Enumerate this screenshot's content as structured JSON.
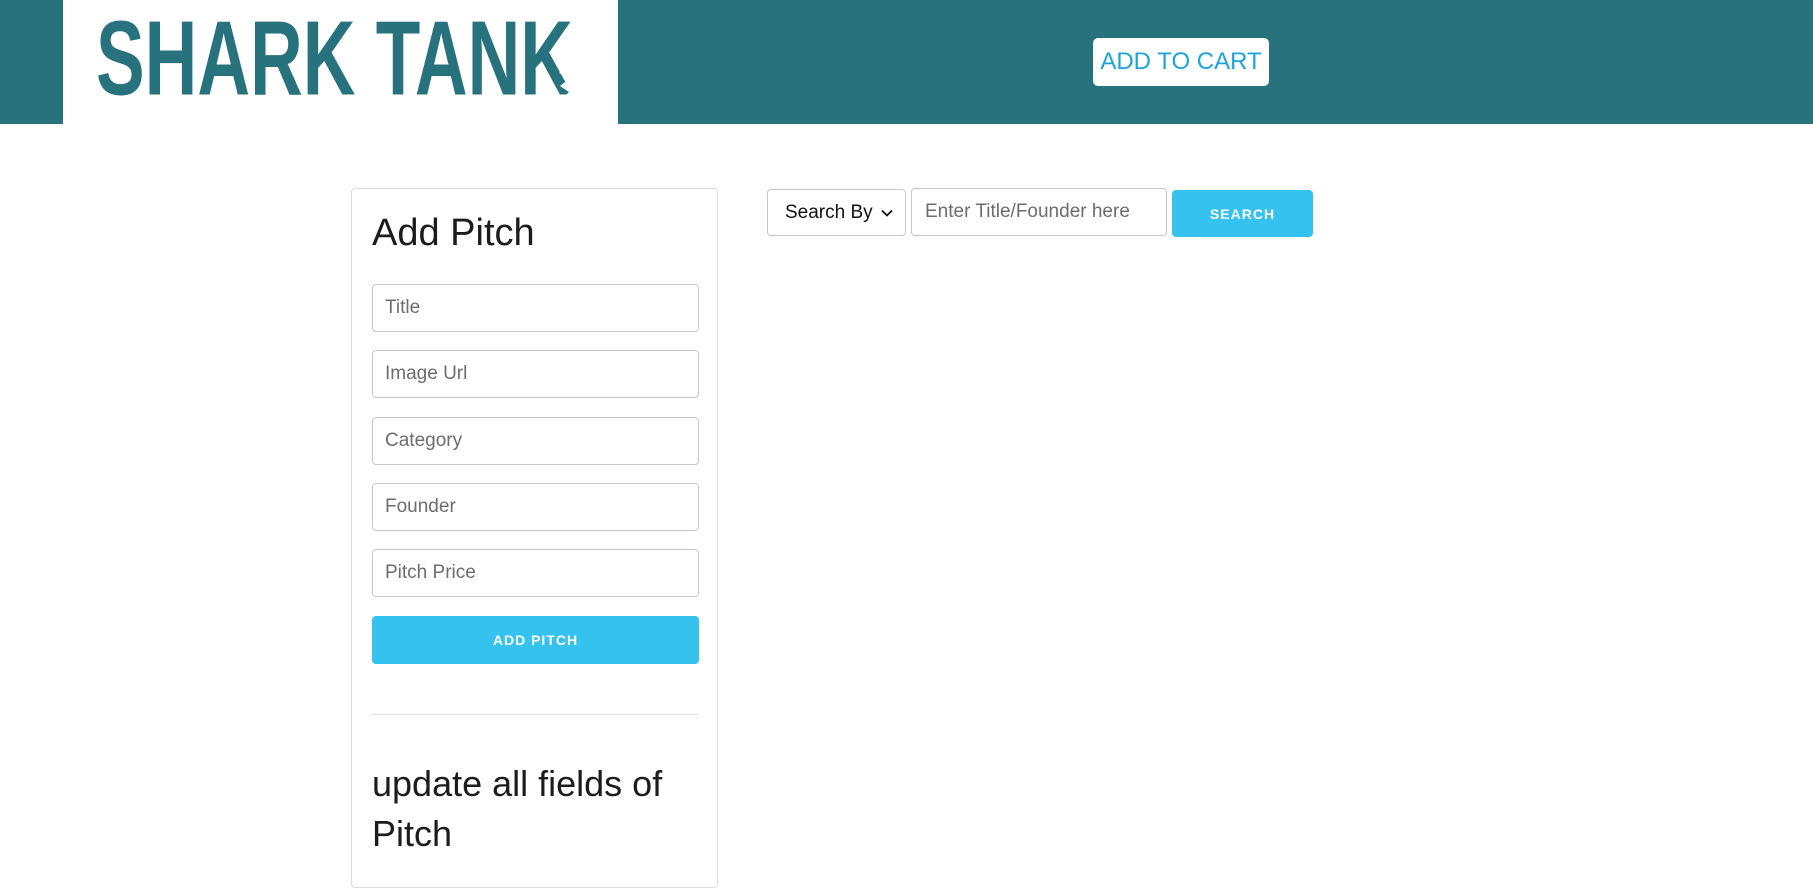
{
  "header": {
    "logo_text": "SHARK TANK",
    "cart_label": "ADD TO CART"
  },
  "add_pitch": {
    "title": "Add Pitch",
    "fields": {
      "title": {
        "placeholder": "Title",
        "value": ""
      },
      "image_url": {
        "placeholder": "Image Url",
        "value": ""
      },
      "category": {
        "placeholder": "Category",
        "value": ""
      },
      "founder": {
        "placeholder": "Founder",
        "value": ""
      },
      "pitch_price": {
        "placeholder": "Pitch Price",
        "value": ""
      }
    },
    "submit_label": "ADD PITCH",
    "update_title": "update all fields of Pitch"
  },
  "search": {
    "select_value": "Search By",
    "input_placeholder": "Enter Title/Founder here",
    "input_value": "",
    "button_label": "SEARCH"
  },
  "colors": {
    "brand": "#28727d",
    "accent": "#35c2ef",
    "cart_text": "#1fa3dc"
  }
}
